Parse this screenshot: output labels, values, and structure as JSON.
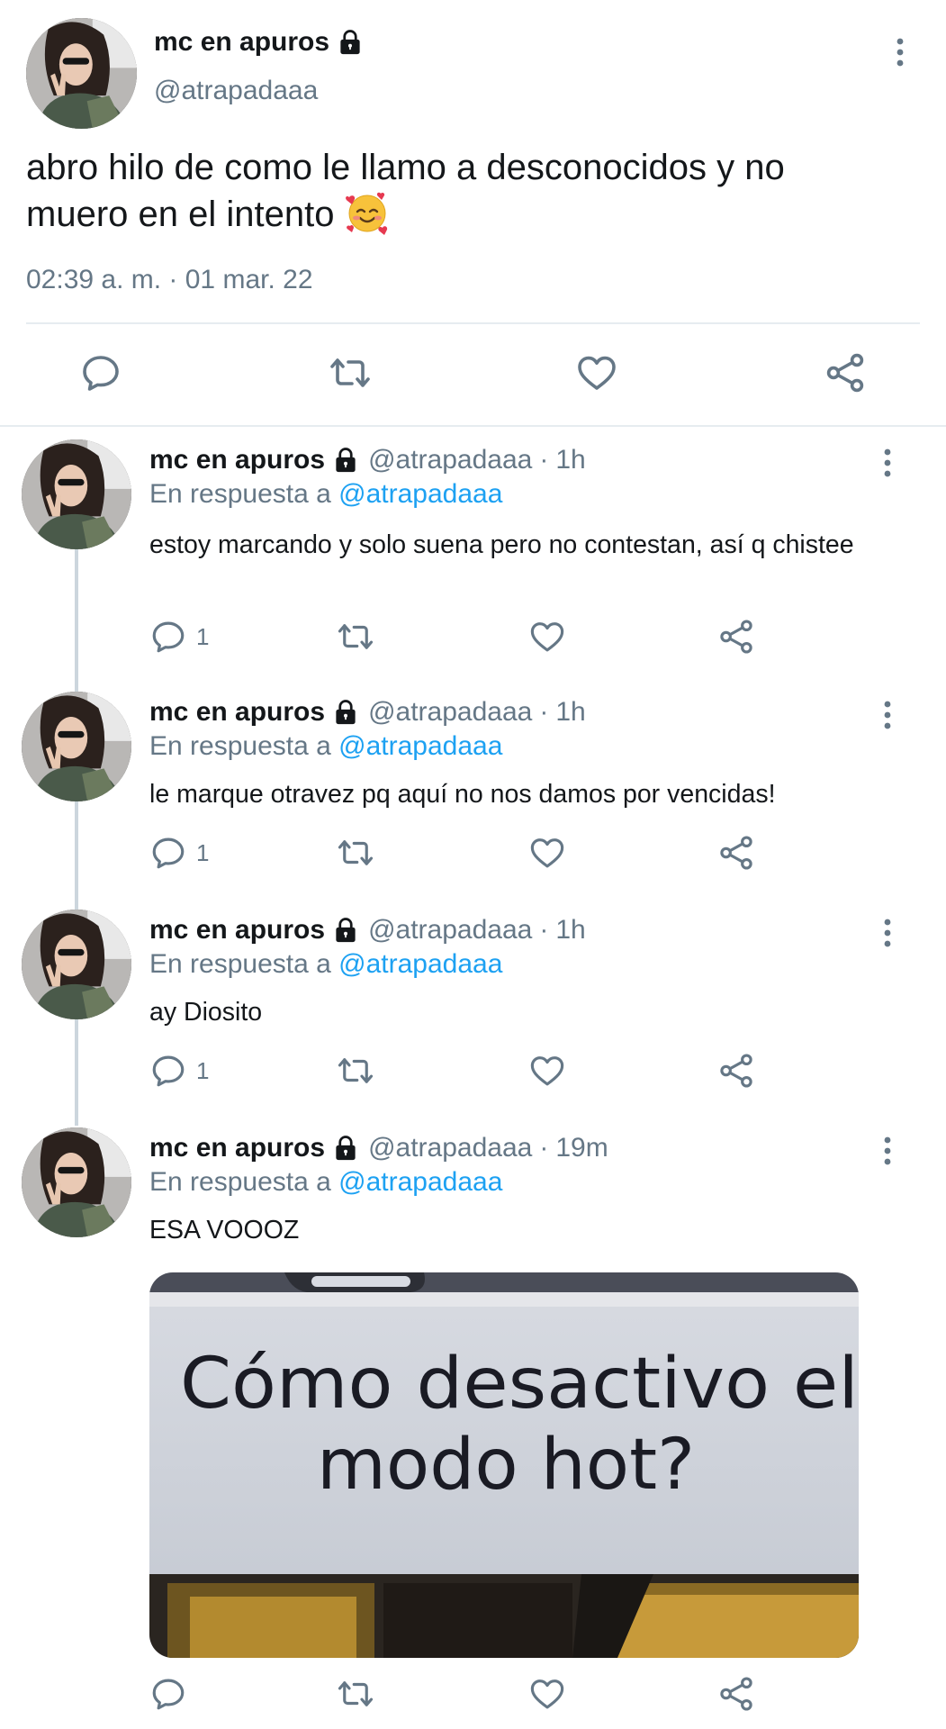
{
  "main_tweet": {
    "display_name": "mc en apuros",
    "handle": "@atrapadaaa",
    "text": "abro hilo de como le llamo a desconocidos y no muero en el intento",
    "emoji": "smiling-face-with-hearts",
    "timestamp": "02:39 a. m. · 01 mar. 22"
  },
  "replies": [
    {
      "display_name": "mc en apuros",
      "handle": "@atrapadaaa",
      "dot": "·",
      "time": "1h",
      "in_reply_prefix": "En respuesta a",
      "in_reply_to": "@atrapadaaa",
      "text": "estoy marcando y solo suena pero no contestan, así q chistee",
      "reply_count": "1"
    },
    {
      "display_name": "mc en apuros",
      "handle": "@atrapadaaa",
      "dot": "·",
      "time": "1h",
      "in_reply_prefix": "En respuesta a",
      "in_reply_to": "@atrapadaaa",
      "text": "le marque otravez pq aquí no nos damos por vencidas!",
      "reply_count": "1"
    },
    {
      "display_name": "mc en apuros",
      "handle": "@atrapadaaa",
      "dot": "·",
      "time": "1h",
      "in_reply_prefix": "En respuesta a",
      "in_reply_to": "@atrapadaaa",
      "text": "ay Diosito",
      "reply_count": "1"
    },
    {
      "display_name": "mc en apuros",
      "handle": "@atrapadaaa",
      "dot": "·",
      "time": "19m",
      "in_reply_prefix": "En respuesta a",
      "in_reply_to": "@atrapadaaa",
      "text": "ESA VOOOZ",
      "media_text_line1": "Cómo desactivo el",
      "media_text_line2": "modo hot?"
    }
  ],
  "icons": {
    "reply": "reply-icon",
    "retweet": "retweet-icon",
    "like": "heart-icon",
    "share": "share-icon",
    "more": "more-vertical-icon",
    "lock": "lock-icon"
  },
  "colors": {
    "text": "#14171a",
    "secondary": "#657786",
    "link": "#1da1f2",
    "divider": "#e6ecf0",
    "thread_line": "#ccd6dd"
  }
}
